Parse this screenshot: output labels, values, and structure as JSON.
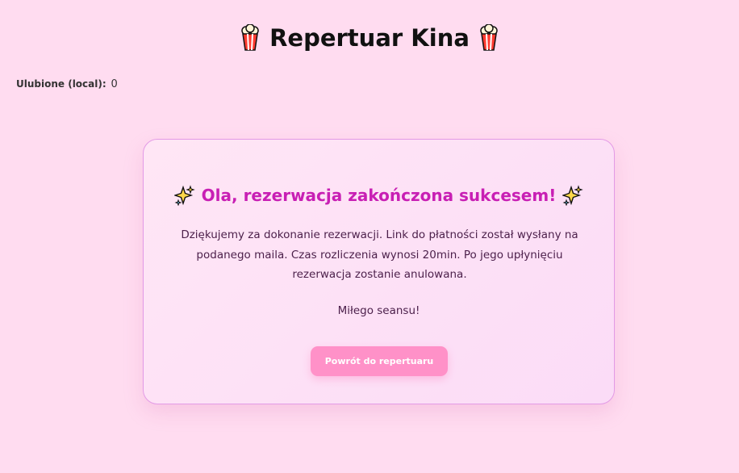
{
  "header": {
    "title": "Repertuar Kina",
    "left_icon": "popcorn-icon",
    "right_icon": "popcorn-icon"
  },
  "favorites": {
    "label": "Ulubione (local):",
    "count": "0"
  },
  "confirmation": {
    "title": "Ola, rezerwacja zakończona sukcesem!",
    "title_icon": "sparkles-icon",
    "message": "Dziękujemy za dokonanie rezerwacji. Link do płatności został wysłany na podanego maila. Czas rozliczenia wynosi 20min. Po jego upłynięciu rezerwacja zostanie anulowana.",
    "closing": "Miłego seansu!",
    "back_button_label": "Powrót do repertuaru"
  },
  "colors": {
    "background": "#ffdcf0",
    "accent_title": "#c81fb4",
    "button": "#ff91c8",
    "card_border": "#e39ae6"
  }
}
